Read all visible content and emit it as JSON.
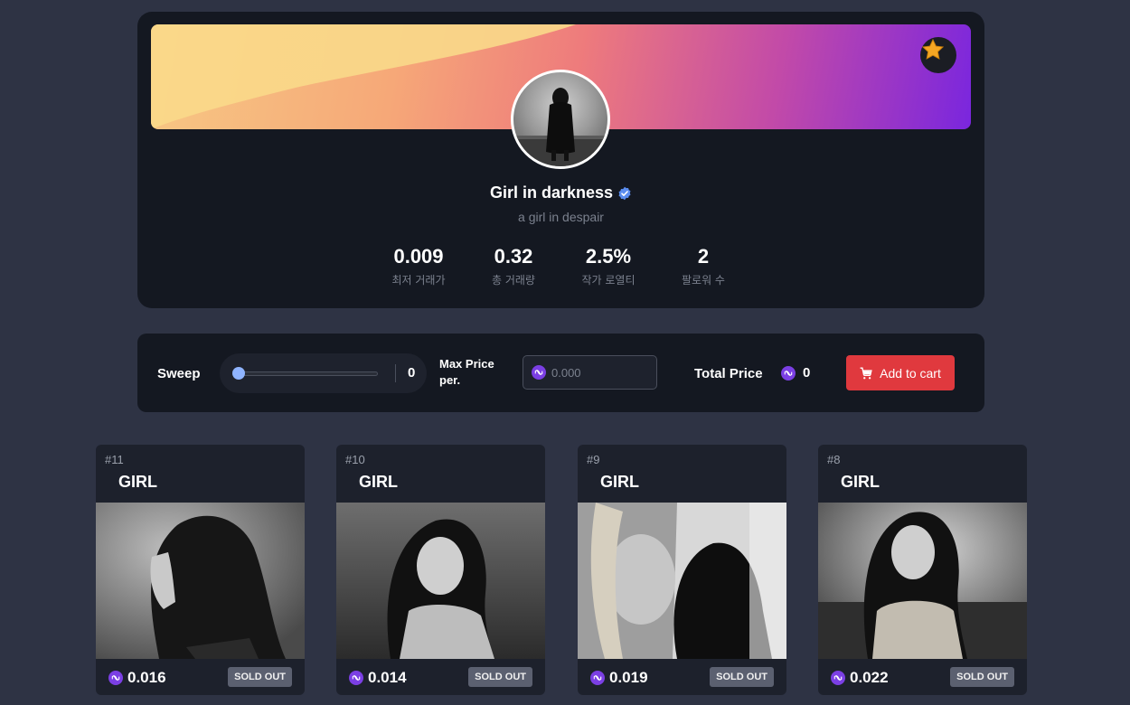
{
  "profile": {
    "name": "Girl in darkness",
    "description": "a girl in despair",
    "stats": [
      {
        "value": "0.009",
        "label": "최저 거래가"
      },
      {
        "value": "0.32",
        "label": "총 거래량"
      },
      {
        "value": "2.5%",
        "label": "작가 로열티"
      },
      {
        "value": "2",
        "label": "팔로워 수"
      }
    ],
    "verified": true,
    "badge_icon": "star-icon"
  },
  "sweep": {
    "label": "Sweep",
    "slider_value": "0",
    "slider_fraction": 0,
    "max_price_label": "Max Price per.",
    "max_price_placeholder": "0.000",
    "total_label": "Total Price",
    "total_value": "0",
    "cart_label": "Add to cart",
    "cart_icon": "cart-icon"
  },
  "nfts": [
    {
      "id": "#11",
      "name": "GIRL",
      "price": "0.016",
      "status": "SOLD OUT"
    },
    {
      "id": "#10",
      "name": "GIRL",
      "price": "0.014",
      "status": "SOLD OUT"
    },
    {
      "id": "#9",
      "name": "GIRL",
      "price": "0.019",
      "status": "SOLD OUT"
    },
    {
      "id": "#8",
      "name": "GIRL",
      "price": "0.022",
      "status": "SOLD OUT"
    }
  ],
  "colors": {
    "background": "#2e3344",
    "card": "#141821",
    "accent_red": "#e0393e",
    "matic_purple": "#7b3fe4",
    "verified_blue": "#5b8def"
  }
}
